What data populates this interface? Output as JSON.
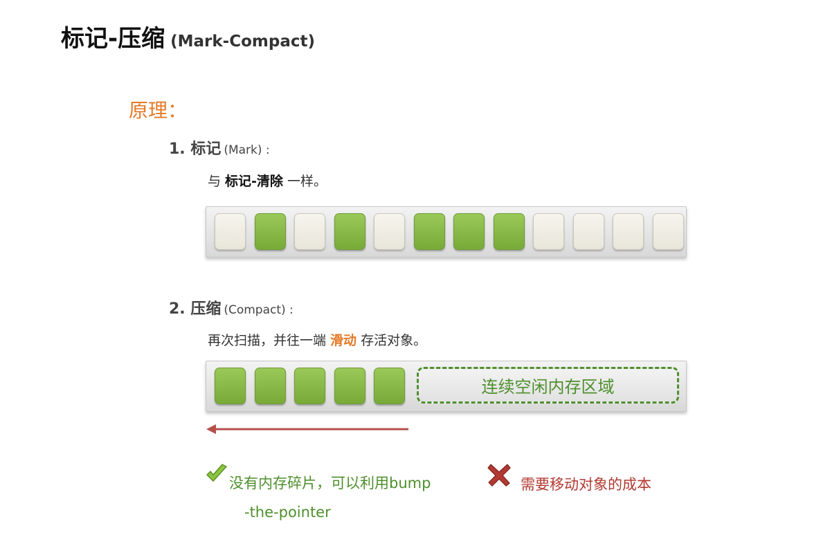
{
  "title": {
    "main": "标记-压缩",
    "sub": "(Mark-Compact)"
  },
  "principle_label": "原理：",
  "steps": [
    {
      "heading": "1.  标记",
      "heading_en": "(Mark) :",
      "desc": {
        "pre": "与 ",
        "bold": "标记-清除",
        "post": " 一样。"
      },
      "cells": [
        "free",
        "live",
        "free",
        "live",
        "free",
        "live",
        "live",
        "live",
        "free",
        "free",
        "free",
        "free"
      ]
    },
    {
      "heading": "2. 压缩",
      "heading_en": "(Compact) :",
      "desc": {
        "pre": "再次扫描，并往一端 ",
        "highlight": "滑动",
        "post": " 存活对象。"
      },
      "cells": [
        "live",
        "live",
        "live",
        "live",
        "live"
      ],
      "free_region_label": "连续空闲内存区域"
    }
  ],
  "pros": {
    "line1": "没有内存碎片，可以利用bump",
    "line2": "-the-pointer",
    "icon": "check-icon",
    "color": "#4e8f2c"
  },
  "cons": {
    "text": "需要移动对象的成本",
    "icon": "cross-icon",
    "color": "#b23a32"
  },
  "arrow": {
    "icon": "left-arrow-icon",
    "color": "#b5504a"
  },
  "colors": {
    "accent": "#e57a27",
    "live_object": "#86b845",
    "free_object": "#efeee6"
  }
}
